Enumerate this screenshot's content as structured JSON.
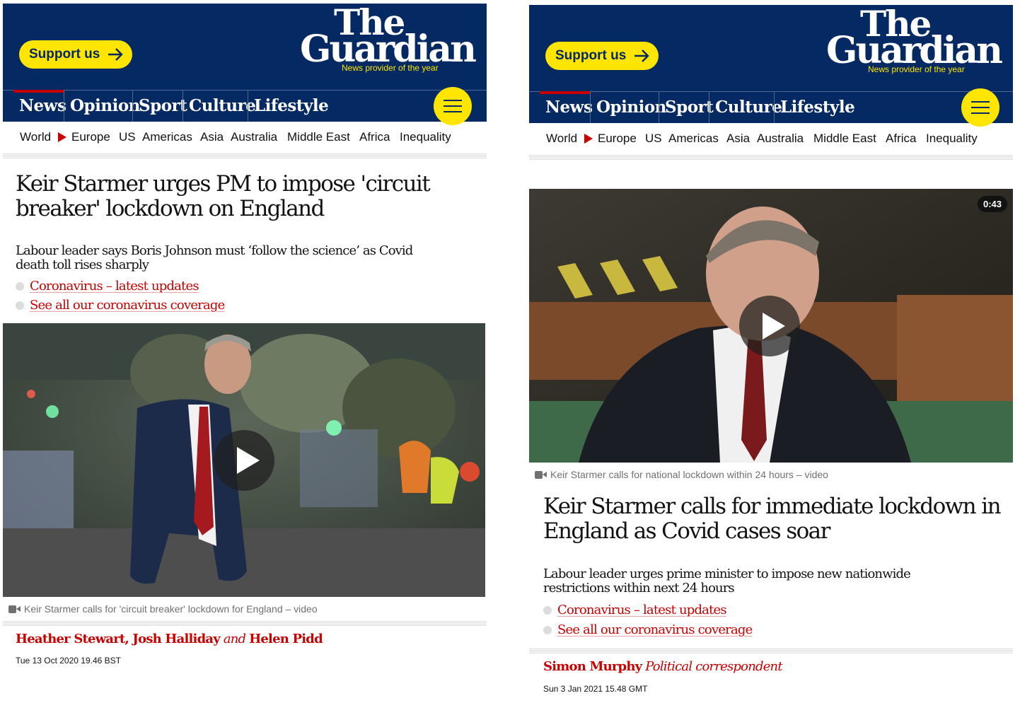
{
  "brand": {
    "support_label": "Support us",
    "logo_the": "The",
    "logo_guardian": "Guardian",
    "tagline": "News provider of the year",
    "navy": "#052962",
    "yellow": "#ffe500",
    "red": "#c70000"
  },
  "pillars": [
    "News",
    "Opinion",
    "Sport",
    "Culture",
    "Lifestyle"
  ],
  "subnav": [
    "World",
    "Europe",
    "US",
    "Americas",
    "Asia",
    "Australia",
    "Middle East",
    "Africa",
    "Inequality"
  ],
  "icons": {
    "support_arrow": "arrow-right-icon",
    "menu": "hamburger-menu-icon",
    "play": "play-icon",
    "video_caption": "video-camera-icon"
  },
  "left": {
    "headline": "Keir Starmer urges PM to impose 'circuit breaker' lockdown on England",
    "standfirst": "Labour leader says Boris Johnson must ‘follow the science’ as Covid death toll rises sharply",
    "links": [
      "Coronavirus – latest updates",
      "See all our coronavirus coverage"
    ],
    "caption": "Keir Starmer calls for 'circuit breaker' lockdown for England – video",
    "byline": {
      "a1": "Heather Stewart",
      "sep1": ", ",
      "a2": "Josh Halliday",
      "and": " and ",
      "a3": "Helen Pidd"
    },
    "date": "Tue 13 Oct 2020 19.46 BST"
  },
  "right": {
    "duration": "0:43",
    "caption": "Keir Starmer calls for national lockdown within 24 hours – video",
    "headline": "Keir Starmer calls for immediate lockdown in England as Covid cases soar",
    "standfirst": "Labour leader urges prime minister to impose new nationwide restrictions within next 24 hours",
    "links": [
      "Coronavirus – latest updates",
      "See all our coronavirus coverage"
    ],
    "byline": {
      "author": "Simon Murphy",
      "role": " Political correspondent"
    },
    "date": "Sun 3 Jan 2021 15.48 GMT"
  }
}
